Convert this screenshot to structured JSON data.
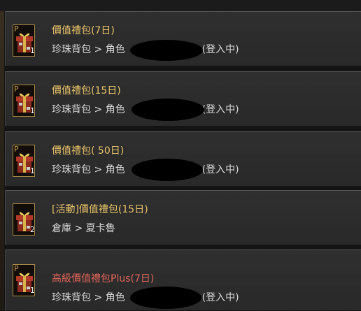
{
  "items": [
    {
      "name": "價值禮包(7日)",
      "location": "珍珠背包 > 角色",
      "status": "登入中",
      "count": "1",
      "slot_mark": "P",
      "name_color": "#e9c46a",
      "icon": "gift-box-icon"
    },
    {
      "name": "價值禮包(15日)",
      "location": "珍珠背包 > 角色",
      "status": "登入中",
      "count": "1",
      "slot_mark": "P",
      "name_color": "#e9c46a",
      "icon": "gift-box-icon"
    },
    {
      "name": "價值禮包( 50日)",
      "location": "珍珠背包 > 角色",
      "status": "登入中",
      "count": "1",
      "slot_mark": "P",
      "name_color": "#e9c46a",
      "icon": "gift-box-icon"
    },
    {
      "name": "[活動]價值禮包(15日)",
      "location": "倉庫 > 夏卡魯",
      "status": "",
      "count": "2",
      "slot_mark": "",
      "name_color": "#e9c46a",
      "icon": "gift-box-icon"
    },
    {
      "name": "高級價值禮包Plus(7日)",
      "location": "珍珠背包 > 角色",
      "status": "登入中",
      "count": "1",
      "slot_mark": "P",
      "name_color": "#e0645a",
      "icon": "gift-box-icon"
    }
  ]
}
